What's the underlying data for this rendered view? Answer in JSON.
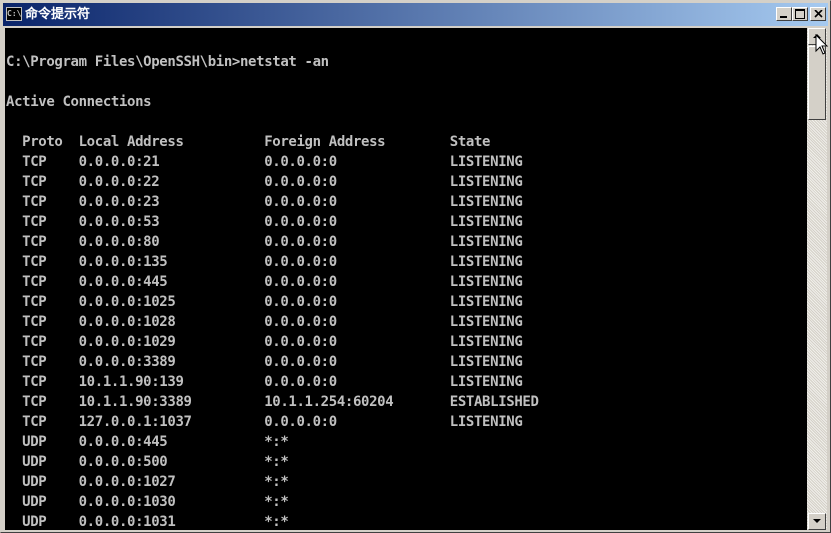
{
  "window": {
    "title": "命令提示符",
    "icon_label": "C:\\",
    "icon": "console-app-icon",
    "buttons": [
      "minimize-icon",
      "maximize-icon",
      "close-icon"
    ]
  },
  "console": {
    "lines": [
      "",
      "C:\\Program Files\\OpenSSH\\bin>netstat -an",
      "",
      "Active Connections",
      "",
      "  Proto  Local Address          Foreign Address        State",
      "  TCP    0.0.0.0:21             0.0.0.0:0              LISTENING",
      "  TCP    0.0.0.0:22             0.0.0.0:0              LISTENING",
      "  TCP    0.0.0.0:23             0.0.0.0:0              LISTENING",
      "  TCP    0.0.0.0:53             0.0.0.0:0              LISTENING",
      "  TCP    0.0.0.0:80             0.0.0.0:0              LISTENING",
      "  TCP    0.0.0.0:135            0.0.0.0:0              LISTENING",
      "  TCP    0.0.0.0:445            0.0.0.0:0              LISTENING",
      "  TCP    0.0.0.0:1025           0.0.0.0:0              LISTENING",
      "  TCP    0.0.0.0:1028           0.0.0.0:0              LISTENING",
      "  TCP    0.0.0.0:1029           0.0.0.0:0              LISTENING",
      "  TCP    0.0.0.0:3389           0.0.0.0:0              LISTENING",
      "  TCP    10.1.1.90:139          0.0.0.0:0              LISTENING",
      "  TCP    10.1.1.90:3389         10.1.1.254:60204       ESTABLISHED",
      "  TCP    127.0.0.1:1037         0.0.0.0:0              LISTENING",
      "  UDP    0.0.0.0:445            *:*",
      "  UDP    0.0.0.0:500            *:*",
      "  UDP    0.0.0.0:1027           *:*",
      "  UDP    0.0.0.0:1030           *:*",
      "  UDP    0.0.0.0:1031           *:*"
    ],
    "foreground": "#c0c0c0",
    "background": "#000000"
  },
  "scrollbar": {
    "up_icon": "scroll-up-arrow-icon",
    "down_icon": "scroll-down-arrow-icon"
  },
  "colors": {
    "titlebar_start": "#0a246a",
    "titlebar_end": "#a6caf0",
    "chrome": "#d4d0c8"
  }
}
